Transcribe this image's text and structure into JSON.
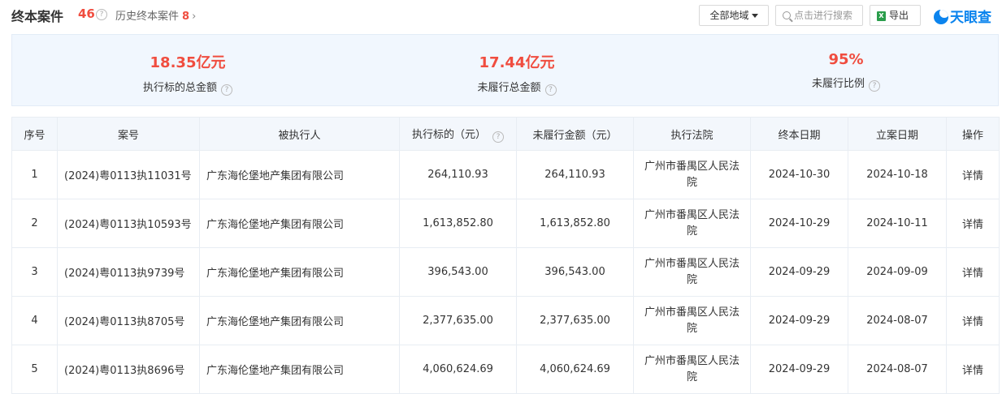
{
  "header": {
    "title": "终本案件",
    "count": "46",
    "history_label": "历史终本案件",
    "history_count": "8",
    "history_arrow": "›",
    "region_label": "全部地域",
    "search_placeholder": "点击进行搜索",
    "export_label": "导出",
    "logo_text": "天眼查"
  },
  "summary": [
    {
      "value": "18.35亿元",
      "label": "执行标的总金额"
    },
    {
      "value": "17.44亿元",
      "label": "未履行总金额"
    },
    {
      "value": "95%",
      "label": "未履行比例"
    }
  ],
  "table": {
    "headers": [
      "序号",
      "案号",
      "被执行人",
      "执行标的（元）",
      "未履行金额（元）",
      "执行法院",
      "终本日期",
      "立案日期",
      "操作"
    ],
    "rows": [
      {
        "index": "1",
        "case_no": "(2024)粤0113执11031号",
        "party": "广东海伦堡地产集团有限公司",
        "amount": "264,110.93",
        "unpaid": "264,110.93",
        "court": "广州市番禺区人民法院",
        "end_date": "2024-10-30",
        "file_date": "2024-10-18",
        "action": "详情"
      },
      {
        "index": "2",
        "case_no": "(2024)粤0113执10593号",
        "party": "广东海伦堡地产集团有限公司",
        "amount": "1,613,852.80",
        "unpaid": "1,613,852.80",
        "court": "广州市番禺区人民法院",
        "end_date": "2024-10-29",
        "file_date": "2024-10-11",
        "action": "详情"
      },
      {
        "index": "3",
        "case_no": "(2024)粤0113执9739号",
        "party": "广东海伦堡地产集团有限公司",
        "amount": "396,543.00",
        "unpaid": "396,543.00",
        "court": "广州市番禺区人民法院",
        "end_date": "2024-09-29",
        "file_date": "2024-09-09",
        "action": "详情"
      },
      {
        "index": "4",
        "case_no": "(2024)粤0113执8705号",
        "party": "广东海伦堡地产集团有限公司",
        "amount": "2,377,635.00",
        "unpaid": "2,377,635.00",
        "court": "广州市番禺区人民法院",
        "end_date": "2024-09-29",
        "file_date": "2024-08-07",
        "action": "详情"
      },
      {
        "index": "5",
        "case_no": "(2024)粤0113执8696号",
        "party": "广东海伦堡地产集团有限公司",
        "amount": "4,060,624.69",
        "unpaid": "4,060,624.69",
        "court": "广州市番禺区人民法院",
        "end_date": "2024-09-29",
        "file_date": "2024-08-07",
        "action": "详情"
      }
    ]
  },
  "colors": {
    "accent_red": "#f04d3f",
    "link_blue": "#0b84ee",
    "summary_bg": "#f1f7fe",
    "header_bg": "#f3f7fc"
  },
  "icons": {
    "help": "question-circle-icon",
    "search": "search-icon",
    "export": "excel-icon",
    "dropdown": "caret-down-icon",
    "logo": "tianyancha-logo"
  }
}
